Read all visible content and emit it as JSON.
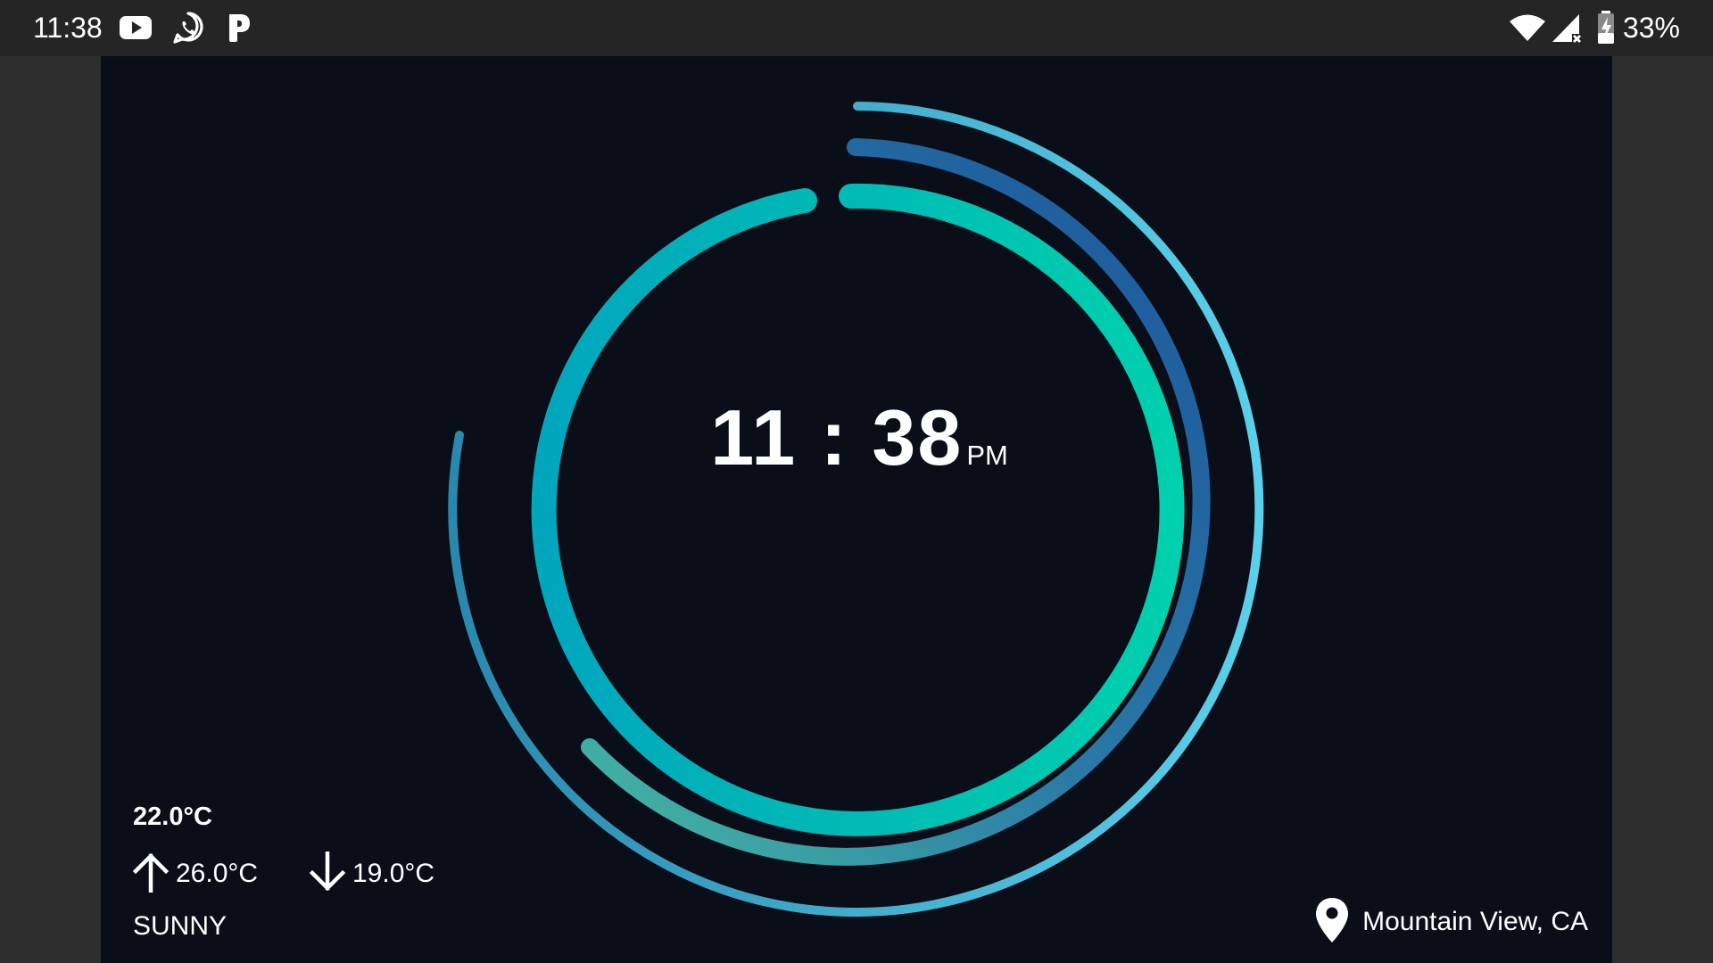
{
  "status_bar": {
    "time": "11:38",
    "notification_icons": [
      "youtube-icon",
      "whatsapp-icon",
      "pandora-icon"
    ],
    "system_icons": [
      "wifi-icon",
      "cellular-no-service-icon",
      "battery-charging-icon"
    ],
    "battery": "33%"
  },
  "clock": {
    "time": "11 : 38",
    "ampm": "PM"
  },
  "weather": {
    "current": "22.0°C",
    "high": "26.0°C",
    "low": "19.0°C",
    "condition": "SUNNY"
  },
  "location": {
    "name": "Mountain View, CA"
  },
  "colors": {
    "background": "#0a0e18",
    "ring_inner": "#00c9b0",
    "ring_middle": "#1f5ea3",
    "ring_outer": "#4fc6e3"
  }
}
